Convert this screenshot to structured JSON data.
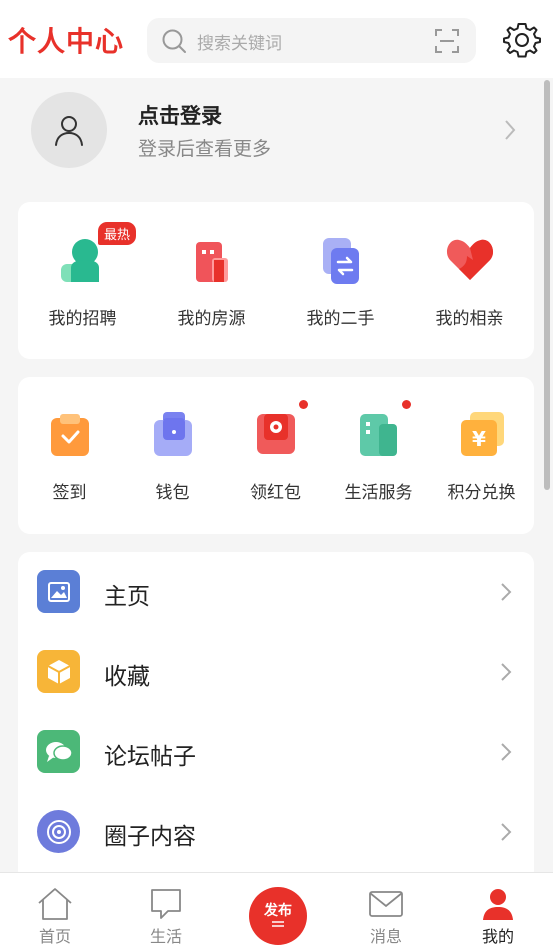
{
  "header": {
    "title": "个人中心",
    "search_placeholder": "搜索关键词",
    "brand_color": "#e8312a"
  },
  "login": {
    "title": "点击登录",
    "subtitle": "登录后查看更多"
  },
  "quick": {
    "badge": "最热",
    "items": [
      {
        "label": "我的招聘",
        "icon": "recruit-icon"
      },
      {
        "label": "我的房源",
        "icon": "house-icon"
      },
      {
        "label": "我的二手",
        "icon": "secondhand-icon"
      },
      {
        "label": "我的相亲",
        "icon": "heart-icon"
      }
    ]
  },
  "services": {
    "items": [
      {
        "label": "签到",
        "icon": "checkin-icon"
      },
      {
        "label": "钱包",
        "icon": "wallet-icon"
      },
      {
        "label": "领红包",
        "icon": "red-packet-icon"
      },
      {
        "label": "生活服务",
        "icon": "life-service-icon"
      },
      {
        "label": "积分兑换",
        "icon": "points-exchange-icon"
      }
    ]
  },
  "menu": {
    "items": [
      {
        "label": "主页",
        "icon": "homepage-icon",
        "color": "#5b7fd6"
      },
      {
        "label": "收藏",
        "icon": "favorite-icon",
        "color": "#f7b538"
      },
      {
        "label": "论坛帖子",
        "icon": "forum-icon",
        "color": "#4cb878"
      },
      {
        "label": "圈子内容",
        "icon": "circle-icon",
        "color": "#6e7bdc"
      }
    ]
  },
  "nav": {
    "items": [
      {
        "label": "首页",
        "icon": "home-icon"
      },
      {
        "label": "生活",
        "icon": "life-icon"
      },
      {
        "label": "消息",
        "icon": "message-icon"
      },
      {
        "label": "我的",
        "icon": "profile-icon"
      }
    ],
    "publish_label": "发布",
    "active": "我的"
  }
}
